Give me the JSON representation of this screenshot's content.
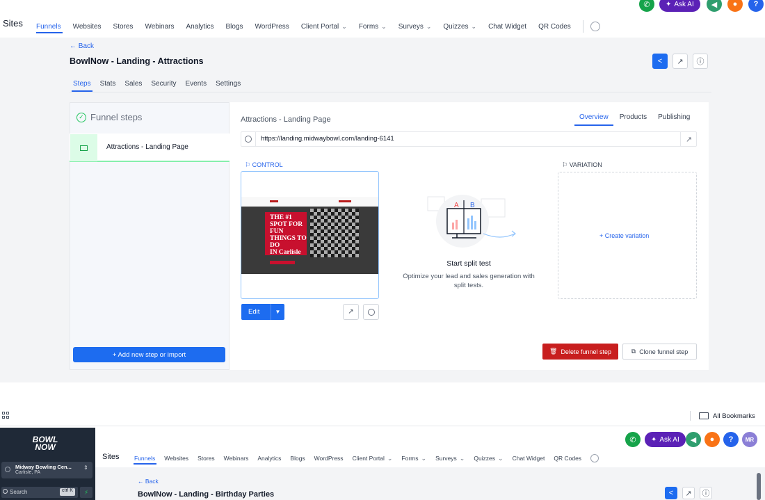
{
  "top_nav": {
    "title": "Sites",
    "links": [
      {
        "label": "Funnels",
        "active": true,
        "dropdown": false
      },
      {
        "label": "Websites",
        "active": false,
        "dropdown": false
      },
      {
        "label": "Stores",
        "active": false,
        "dropdown": false
      },
      {
        "label": "Webinars",
        "active": false,
        "dropdown": false
      },
      {
        "label": "Analytics",
        "active": false,
        "dropdown": false
      },
      {
        "label": "Blogs",
        "active": false,
        "dropdown": false
      },
      {
        "label": "WordPress",
        "active": false,
        "dropdown": false
      },
      {
        "label": "Client Portal",
        "active": false,
        "dropdown": true
      },
      {
        "label": "Forms",
        "active": false,
        "dropdown": true
      },
      {
        "label": "Surveys",
        "active": false,
        "dropdown": true
      },
      {
        "label": "Quizzes",
        "active": false,
        "dropdown": true
      },
      {
        "label": "Chat Widget",
        "active": false,
        "dropdown": false
      },
      {
        "label": "QR Codes",
        "active": false,
        "dropdown": false
      }
    ],
    "ask_ai_label": "Ask AI",
    "help_label": "?",
    "user_initials": "MR"
  },
  "page": {
    "back_label": "← Back",
    "title": "BowlNow - Landing - Attractions",
    "subtabs": [
      {
        "label": "Steps",
        "active": true
      },
      {
        "label": "Stats",
        "active": false
      },
      {
        "label": "Sales",
        "active": false
      },
      {
        "label": "Security",
        "active": false
      },
      {
        "label": "Events",
        "active": false
      },
      {
        "label": "Settings",
        "active": false
      }
    ]
  },
  "steps_panel": {
    "header": "Funnel steps",
    "steps": [
      {
        "label": "Attractions - Landing Page"
      }
    ],
    "add_button": "+ Add new step or import"
  },
  "step_detail": {
    "title": "Attractions - Landing Page",
    "tabs": [
      {
        "label": "Overview",
        "active": true
      },
      {
        "label": "Products",
        "active": false
      },
      {
        "label": "Publishing",
        "active": false
      }
    ],
    "url": "https://landing.midwaybowl.com/landing-6141",
    "control_label": "CONTROL",
    "variation_label": "VARIATION",
    "thumbnail_text": [
      "THE #1",
      "SPOT FOR",
      "FUN",
      "THINGS TO",
      "DO",
      "IN Carlisle"
    ],
    "edit_label": "Edit",
    "split_test": {
      "title": "Start split test",
      "description": "Optimize your lead and sales generation with split tests.",
      "a": "A",
      "b": "B"
    },
    "create_variation_label": "+ Create variation",
    "delete_label": "Delete funnel step",
    "clone_label": "Clone funnel step"
  },
  "browser": {
    "bookmarks_label": "All Bookmarks"
  },
  "second_view": {
    "logo_line1": "BOWL",
    "logo_line2": "NOW",
    "location_name": "Midway Bowling Cen...",
    "location_sub": "Carlisle, PA",
    "search_placeholder": "Search",
    "search_shortcut": "ctrl K",
    "title": "Sites",
    "links": [
      {
        "label": "Funnels",
        "active": true,
        "dropdown": false
      },
      {
        "label": "Websites",
        "active": false,
        "dropdown": false
      },
      {
        "label": "Stores",
        "active": false,
        "dropdown": false
      },
      {
        "label": "Webinars",
        "active": false,
        "dropdown": false
      },
      {
        "label": "Analytics",
        "active": false,
        "dropdown": false
      },
      {
        "label": "Blogs",
        "active": false,
        "dropdown": false
      },
      {
        "label": "WordPress",
        "active": false,
        "dropdown": false
      },
      {
        "label": "Client Portal",
        "active": false,
        "dropdown": true
      },
      {
        "label": "Forms",
        "active": false,
        "dropdown": true
      },
      {
        "label": "Surveys",
        "active": false,
        "dropdown": true
      },
      {
        "label": "Quizzes",
        "active": false,
        "dropdown": true
      },
      {
        "label": "Chat Widget",
        "active": false,
        "dropdown": false
      },
      {
        "label": "QR Codes",
        "active": false,
        "dropdown": false
      }
    ],
    "back_label": "← Back",
    "page_title": "BowlNow - Landing - Birthday Parties"
  },
  "colors": {
    "primary": "#1d6cf0",
    "danger": "#c81e1e",
    "success": "#22c55e",
    "ai_purple": "#5b21b6",
    "announce_green": "#2f9e6e",
    "notify_orange": "#f97316",
    "help_blue": "#2563eb",
    "avatar_purple": "#8b7fd6"
  },
  "icons": {
    "phone": "phone-icon",
    "sparkle": "sparkle-icon",
    "megaphone": "megaphone-icon",
    "bell": "bell-icon",
    "help": "help-icon",
    "settings": "gear-icon",
    "share": "share-icon",
    "open": "external-link-icon",
    "info": "info-icon",
    "trash": "trash-icon",
    "copy": "copy-icon"
  }
}
